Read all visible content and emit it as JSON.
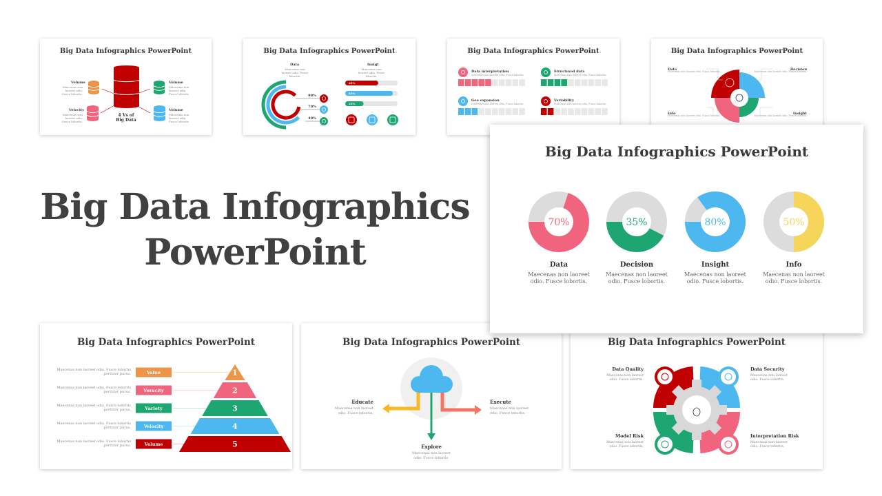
{
  "hero_title": {
    "line1": "Big Data Infographics",
    "line2": "PowerPoint"
  },
  "slide_title": "Big Data Infographics PowerPoint",
  "desc": "Maecenas non laoreet odio. Fusce lobortis.",
  "colors": {
    "red": "#c00000",
    "pink": "#f0647e",
    "green": "#1ea672",
    "blue": "#4db8f0",
    "yellow": "#f5d55a",
    "orange": "#ec9549",
    "gray": "#dcdcdc",
    "coral": "#f57464",
    "amber": "#fbb826"
  },
  "slide1": {
    "center": "4 Vs of Big Data",
    "items": [
      {
        "label": "Volume",
        "color": "orange"
      },
      {
        "label": "Volume",
        "color": "green"
      },
      {
        "label": "Velocity",
        "color": "pink"
      },
      {
        "label": "Volume",
        "color": "blue"
      }
    ]
  },
  "slide2": {
    "left_heading": "Data",
    "right_heading": "Insigt",
    "rings": [
      {
        "value": "90%",
        "color": "red"
      },
      {
        "value": "70%",
        "color": "blue"
      },
      {
        "value": "40%",
        "color": "green"
      }
    ],
    "bars": [
      {
        "value": 45,
        "label": "45%",
        "color": "red"
      },
      {
        "value": 65,
        "label": "65%",
        "color": "blue"
      },
      {
        "value": 25,
        "label": "25%",
        "color": "green"
      }
    ]
  },
  "slide3": {
    "items": [
      {
        "label": "Data interpretation",
        "filled": 5,
        "total": 10,
        "color": "pink"
      },
      {
        "label": "Structured data",
        "filled": 4,
        "total": 10,
        "color": "green"
      },
      {
        "label": "Geo expansion",
        "filled": 3,
        "total": 10,
        "color": "blue"
      },
      {
        "label": "Variability",
        "filled": 2,
        "total": 10,
        "color": "red"
      }
    ]
  },
  "slide4": {
    "items": [
      "Data",
      "Decision",
      "Info",
      "Insight"
    ]
  },
  "featured": {
    "donuts": [
      {
        "label": "Data",
        "value": 70,
        "text": "70%",
        "color": "pink"
      },
      {
        "label": "Decision",
        "value": 35,
        "text": "35%",
        "color": "green"
      },
      {
        "label": "Insight",
        "value": 80,
        "text": "80%",
        "color": "blue"
      },
      {
        "label": "Info",
        "value": 50,
        "text": "50%",
        "color": "yellow"
      }
    ]
  },
  "pyramid": {
    "desc": "Maecenas non laoreet odio. Fusce lobortis porttitor purus.",
    "levels": [
      {
        "label": "Value",
        "num": "1",
        "color": "orange"
      },
      {
        "label": "Veracity",
        "num": "2",
        "color": "pink"
      },
      {
        "label": "Variety",
        "num": "3",
        "color": "green"
      },
      {
        "label": "Velocity",
        "num": "4",
        "color": "blue"
      },
      {
        "label": "Volume",
        "num": "5",
        "color": "red"
      }
    ]
  },
  "cloud": {
    "items": [
      {
        "label": "Educate"
      },
      {
        "label": "Execute"
      },
      {
        "label": "Explore"
      }
    ]
  },
  "gear": {
    "items": [
      "Data Quality",
      "Data Security",
      "Model Risk",
      "Interpretation Risk"
    ]
  }
}
